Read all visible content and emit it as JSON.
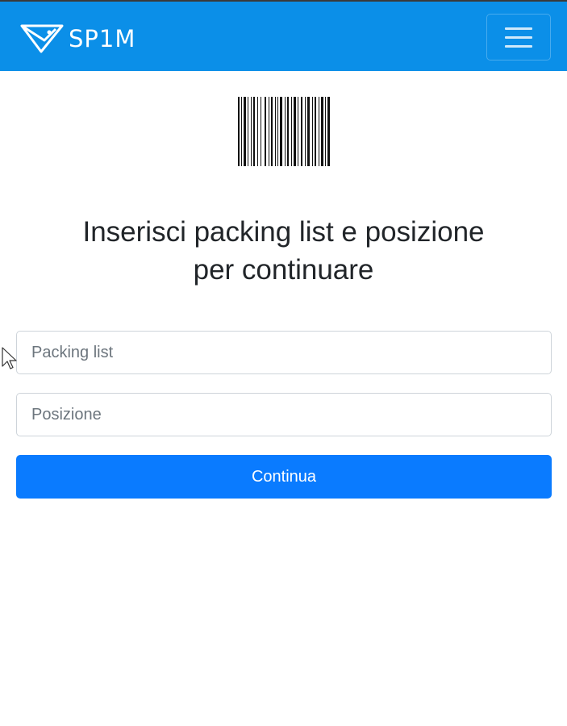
{
  "brand": {
    "name": "SP1M",
    "logo_icon": "swallow-logo-icon"
  },
  "colors": {
    "navbar": "#0b8fe8",
    "primary_button": "#0a7bff",
    "heading_text": "#212529"
  },
  "navbar": {
    "menu_icon": "hamburger-menu-icon"
  },
  "scanner": {
    "icon": "barcode-icon"
  },
  "form": {
    "heading_line1": "Inserisci packing list e posizione",
    "heading_line2": "per continuare",
    "packing_list_placeholder": "Packing list",
    "position_placeholder": "Posizione",
    "submit_label": "Continua"
  }
}
